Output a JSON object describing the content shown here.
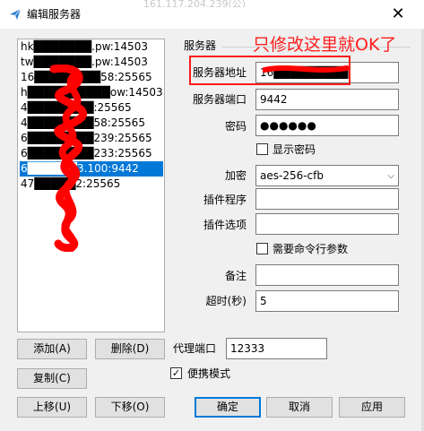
{
  "window": {
    "title": "编辑服务器",
    "ghost_text": "161.117.204.239(公)",
    "close_label": "✕"
  },
  "server_list": {
    "items": [
      {
        "text": "hk███████.pw:14503",
        "selected": false
      },
      {
        "text": "tw███████.pw:14503",
        "selected": false
      },
      {
        "text": "16████████58:25565",
        "selected": false
      },
      {
        "text": "h██████████ow:14503",
        "selected": false
      },
      {
        "text": "4████████:25565",
        "selected": false
      },
      {
        "text": "4████████58:25565",
        "selected": false
      },
      {
        "text": "6████████239:25565",
        "selected": false
      },
      {
        "text": "6████████233:25565",
        "selected": false
      },
      {
        "text": "6██████3.100:9442",
        "selected": true
      },
      {
        "text": "47█████2:25565",
        "selected": false
      }
    ]
  },
  "group": {
    "title": "服务器"
  },
  "annotation": "只修改这里就OK了",
  "form": {
    "server_address": {
      "label": "服务器地址",
      "value": "16█████████"
    },
    "server_port": {
      "label": "服务器端口",
      "value": "9442"
    },
    "password": {
      "label": "密码",
      "value": "●●●●●●"
    },
    "show_password": {
      "label": "显示密码",
      "checked": false
    },
    "encryption": {
      "label": "加密",
      "value": "aes-256-cfb"
    },
    "plugin_program": {
      "label": "插件程序",
      "value": ""
    },
    "plugin_options": {
      "label": "插件选项",
      "value": ""
    },
    "need_cmd_args": {
      "label": "需要命令行参数",
      "checked": false
    },
    "remarks": {
      "label": "备注",
      "value": ""
    },
    "timeout": {
      "label": "超时(秒)",
      "value": "5"
    }
  },
  "proxy_port": {
    "label": "代理端口",
    "value": "12333"
  },
  "portable_mode": {
    "label": "便携模式",
    "checked": true,
    "check_glyph": "✓"
  },
  "buttons": {
    "add": "添加(A)",
    "delete": "删除(D)",
    "copy": "复制(C)",
    "move_up": "上移(U)",
    "move_down": "下移(O)",
    "ok": "确定",
    "cancel": "取消",
    "apply": "应用"
  },
  "colors": {
    "accent": "#0078d7",
    "annotation": "#ff2020",
    "scribble": "#ff0000"
  }
}
